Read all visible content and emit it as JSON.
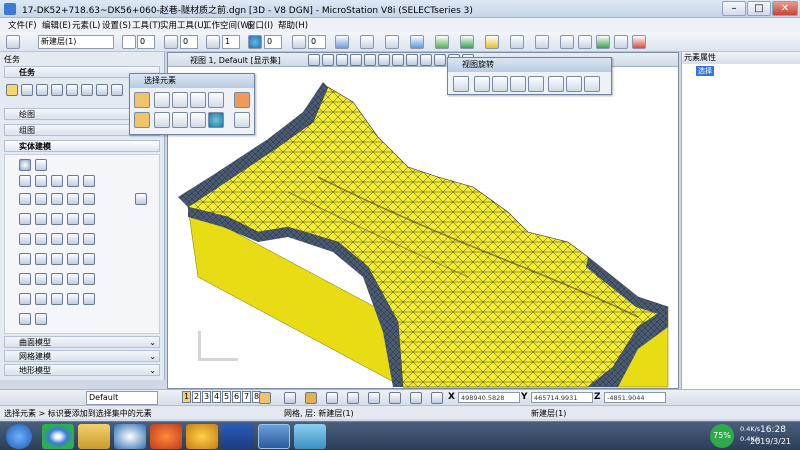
{
  "window": {
    "title": "17-DK52+718.63~DK56+060-赵巷-隧材质之前.dgn [3D - V8 DGN] - MicroStation V8i (SELECTseries 3)"
  },
  "menu": [
    "文件(F)",
    "编辑(E)",
    "元素(L)",
    "设置(S)",
    "工具(T)",
    "实用工具(U)",
    "工作空间(W)",
    "窗口(I)",
    "帮助(H)"
  ],
  "toolbar": {
    "level": "新建层(1)",
    "color_value": "0",
    "style_value": "0",
    "weight_value": "1",
    "transparency_value": "0",
    "priority_value": "0"
  },
  "tasks": {
    "panel_title": "任务",
    "header": "任务",
    "groups": [
      "绘图",
      "组图"
    ],
    "active_group": "实体建模",
    "collapsed": [
      "曲面模型",
      "网格建模",
      "地形模型"
    ]
  },
  "select_element": {
    "title": "选择元素"
  },
  "view_rotation": {
    "title": "视图旋转"
  },
  "view": {
    "title": "视图 1, Default [显示集]"
  },
  "element_properties": {
    "title": "元素属性",
    "item": "选择"
  },
  "bottom": {
    "level_select": "Default",
    "views": [
      "1",
      "2",
      "3",
      "4",
      "5",
      "6",
      "7",
      "8"
    ],
    "x_label": "X",
    "x_value": "498940.5828",
    "y_label": "Y",
    "y_value": "465714.9931",
    "z_label": "Z",
    "z_value": "-4851.9044"
  },
  "status": {
    "prompt": "选择元素 > 标识要添加到选择集中的元素",
    "level_text": "网格, 层: 新建层(1)",
    "active_level": "新建层(1)"
  },
  "taskbar": {
    "time": "16:28",
    "date": "2019/3/21",
    "cpu": "75%",
    "up": "0.4K/s",
    "down": "0.4K/s"
  },
  "colors": {
    "terrain_yellow": "#f4ec2e",
    "terrain_side": "#e8dc14",
    "rock": "#3c4a5c"
  }
}
